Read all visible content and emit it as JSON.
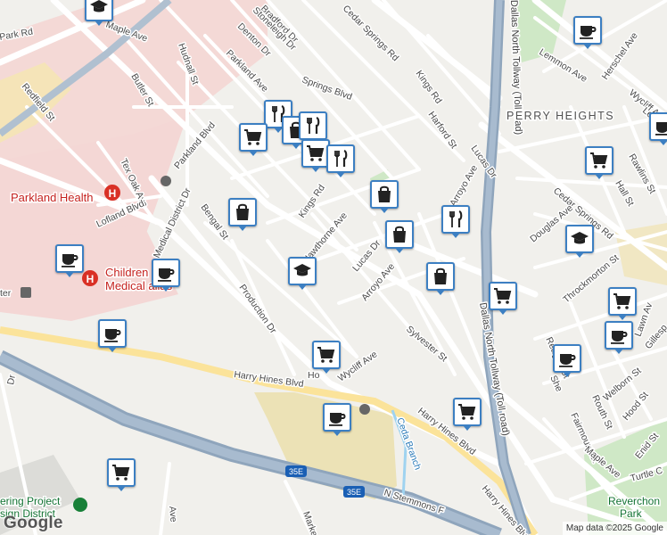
{
  "map": {
    "roads": [
      {
        "id": "maple-ave-top",
        "name": "Maple Ave"
      },
      {
        "id": "park-rd",
        "name": "Park Rd"
      },
      {
        "id": "bradford-dr",
        "name": "Bradford Dr"
      },
      {
        "id": "stoneleigh-dr",
        "name": "Stoneleigh Dr"
      },
      {
        "id": "cedar-springs-rd-top",
        "name": "Cedar Springs Rd"
      },
      {
        "id": "hudnall-st",
        "name": "Hudnall St"
      },
      {
        "id": "denton-dr",
        "name": "Denton Dr"
      },
      {
        "id": "parkland-ave",
        "name": "Parkland Ave"
      },
      {
        "id": "butler-st",
        "name": "Butler St"
      },
      {
        "id": "springs-blvd",
        "name": "Springs Blvd"
      },
      {
        "id": "kings-rd-north",
        "name": "Kings Rd"
      },
      {
        "id": "harford-st",
        "name": "Harford St"
      },
      {
        "id": "lucas-dr-north",
        "name": "Lucas Dr"
      },
      {
        "id": "redfield-st",
        "name": "Redfield St"
      },
      {
        "id": "tex-oak-ave",
        "name": "Tex Oak Ave"
      },
      {
        "id": "parkland-blvd",
        "name": "Parkland Blvd"
      },
      {
        "id": "lofland-blvd",
        "name": "Lofland Blvd"
      },
      {
        "id": "medical-district-dr",
        "name": "Medical District Dr"
      },
      {
        "id": "bengal-st",
        "name": "Bengal St"
      },
      {
        "id": "kings-rd",
        "name": "Kings Rd"
      },
      {
        "id": "hawthorne-ave",
        "name": "Hawthorne Ave"
      },
      {
        "id": "lucas-dr",
        "name": "Lucas Dr"
      },
      {
        "id": "arroyo-ave",
        "name": "Arroyo Ave"
      },
      {
        "id": "arroyo-ave-north",
        "name": "Arroyo Ave"
      },
      {
        "id": "production-dr",
        "name": "Production Dr"
      },
      {
        "id": "wycliff-ave",
        "name": "Wycliff Ave"
      },
      {
        "id": "wycliff-ave-top",
        "name": "Wycliff Ave"
      },
      {
        "id": "sylvester-st",
        "name": "Sylvester St"
      },
      {
        "id": "harry-hines-blvd-west",
        "name": "Harry Hines Blvd"
      },
      {
        "id": "harry-hines-blvd-east",
        "name": "Harry Hines Blvd"
      },
      {
        "id": "harry-hines-blvd-south",
        "name": "Harry Hines Blvd"
      },
      {
        "id": "dallas-north-tollway-north",
        "name": "Dallas North Tollway (Toll road)"
      },
      {
        "id": "dallas-north-tollway-south",
        "name": "Dallas North Tollway (Toll road)"
      },
      {
        "id": "cedar-springs-rd-east",
        "name": "Cedar Springs Rd"
      },
      {
        "id": "lemmon-ave",
        "name": "Lemmon Ave"
      },
      {
        "id": "lemmon-ave-east",
        "name": "Lemmon Ave"
      },
      {
        "id": "herschel-ave",
        "name": "Herschel Ave"
      },
      {
        "id": "rawlins-st",
        "name": "Rawlins St"
      },
      {
        "id": "hall-st",
        "name": "Hall St"
      },
      {
        "id": "douglas-ave",
        "name": "Douglas Ave"
      },
      {
        "id": "throckmorton-st",
        "name": "Throckmorton St"
      },
      {
        "id": "reagan-st",
        "name": "Reagan St"
      },
      {
        "id": "shelby-st",
        "name": "She"
      },
      {
        "id": "welborn-st",
        "name": "Welborn St"
      },
      {
        "id": "gillespie-st",
        "name": "Gillesp"
      },
      {
        "id": "routh-st",
        "name": "Routh St"
      },
      {
        "id": "hood-st",
        "name": "Hood St"
      },
      {
        "id": "fairmount-st",
        "name": "Fairmount St"
      },
      {
        "id": "maple-ave-east",
        "name": "Maple Ave"
      },
      {
        "id": "enid-st",
        "name": "Enid St"
      },
      {
        "id": "turtle-creek",
        "name": "Turtle C"
      },
      {
        "id": "lawn-ave",
        "name": "Lawn Av"
      },
      {
        "id": "n-stemmons-fwy",
        "name": "N Stemmons F"
      },
      {
        "id": "market-st",
        "name": "Marke"
      },
      {
        "id": "ave-west",
        "name": "Ave"
      },
      {
        "id": "redfield-dr-west",
        "name": "Dr"
      },
      {
        "id": "ho-st",
        "name": "Ho"
      },
      {
        "id": "cedar-branch",
        "name": "Ceda Branch"
      }
    ],
    "shields": [
      {
        "id": "shield-35e-west",
        "label": "35E"
      },
      {
        "id": "shield-35e-east",
        "label": "35E"
      }
    ],
    "areas": [
      {
        "id": "perry-heights",
        "name": "PERRY HEIGHTS"
      },
      {
        "id": "parkland-health",
        "name": "Parkland Health"
      },
      {
        "id": "childrens-medical-line1",
        "name": "Children"
      },
      {
        "id": "childrens-medical-line2",
        "name": "Medical       allas"
      },
      {
        "id": "engineering-project-line1",
        "name": "ering Project"
      },
      {
        "id": "engineering-project-line2",
        "name": "sign District"
      },
      {
        "id": "reverchon-park-line1",
        "name": "Reverchon"
      },
      {
        "id": "reverchon-park-line2",
        "name": "Park"
      },
      {
        "id": "center-west",
        "name": "ter"
      }
    ],
    "markers": [
      {
        "id": "marker-education-top",
        "icon": "graduation-cap-icon"
      },
      {
        "id": "marker-cafe-lemmon",
        "icon": "coffee-cup-icon"
      },
      {
        "id": "marker-restaurant-1",
        "icon": "fork-knife-icon"
      },
      {
        "id": "marker-shopping-1",
        "icon": "shopping-bag-icon"
      },
      {
        "id": "marker-grocery-1",
        "icon": "shopping-cart-icon"
      },
      {
        "id": "marker-restaurant-2",
        "icon": "fork-knife-icon"
      },
      {
        "id": "marker-cafe-perry",
        "icon": "coffee-cup-icon"
      },
      {
        "id": "marker-grocery-2",
        "icon": "shopping-cart-icon"
      },
      {
        "id": "marker-shopping-2",
        "icon": "shopping-bag-icon"
      },
      {
        "id": "marker-shopping-3",
        "icon": "shopping-bag-icon"
      },
      {
        "id": "marker-restaurant-3",
        "icon": "fork-knife-icon"
      },
      {
        "id": "marker-education-douglas",
        "icon": "graduation-cap-icon"
      },
      {
        "id": "marker-cafe-childrens",
        "icon": "coffee-cup-icon"
      },
      {
        "id": "marker-cafe-medical",
        "icon": "coffee-cup-icon"
      },
      {
        "id": "marker-education-lucas",
        "icon": "graduation-cap-icon"
      },
      {
        "id": "marker-shopping-4",
        "icon": "shopping-bag-icon"
      },
      {
        "id": "marker-grocery-3",
        "icon": "shopping-cart-icon"
      },
      {
        "id": "marker-grocery-4",
        "icon": "shopping-cart-icon"
      },
      {
        "id": "marker-cafe-lawn",
        "icon": "coffee-cup-icon"
      },
      {
        "id": "marker-cafe-production",
        "icon": "coffee-cup-icon"
      },
      {
        "id": "marker-grocery-wycliff",
        "icon": "shopping-cart-icon"
      },
      {
        "id": "marker-cafe-reagan",
        "icon": "coffee-cup-icon"
      },
      {
        "id": "marker-cafe-harry-hines",
        "icon": "coffee-cup-icon"
      },
      {
        "id": "marker-grocery-harry-hines",
        "icon": "shopping-cart-icon"
      },
      {
        "id": "marker-grocery-stemmons",
        "icon": "shopping-cart-icon"
      }
    ],
    "attribution": "Map data ©2025 Google",
    "logo": "Google",
    "colors": {
      "marker_border": "#3c7fc2",
      "hospital_area": "#f4d7d5",
      "hospital_text": "#c5221f",
      "park": "#c8e6c0",
      "freeway": "#8a9fb5"
    }
  }
}
